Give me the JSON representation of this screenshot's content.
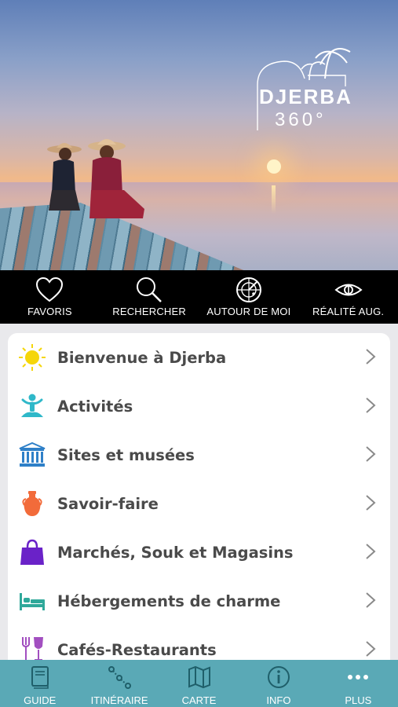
{
  "hero": {
    "logo_line1": "DJERBA",
    "logo_line2": "360°"
  },
  "actions": [
    {
      "label": "FAVORIS",
      "icon": "heart-icon"
    },
    {
      "label": "RECHERCHER",
      "icon": "search-icon"
    },
    {
      "label": "AUTOUR DE MOI",
      "icon": "radar-icon"
    },
    {
      "label": "RÉALITÉ AUG.",
      "icon": "eye-icon"
    }
  ],
  "menu": [
    {
      "label": "Bienvenue à Djerba",
      "icon": "sun-icon",
      "color": "#f5d60a"
    },
    {
      "label": "Activités",
      "icon": "yoga-icon",
      "color": "#2fb8c9"
    },
    {
      "label": "Sites et musées",
      "icon": "museum-icon",
      "color": "#2f80c8"
    },
    {
      "label": "Savoir-faire",
      "icon": "amphora-icon",
      "color": "#f26b3a"
    },
    {
      "label": "Marchés, Souk et Magasins",
      "icon": "shopping-bag-icon",
      "color": "#6a22c8"
    },
    {
      "label": "Hébergements de charme",
      "icon": "bed-icon",
      "color": "#2fa89a"
    },
    {
      "label": "Cafés-Restaurants",
      "icon": "cutlery-glass-icon",
      "color": "#a24fc0"
    }
  ],
  "tabs": [
    {
      "label": "GUIDE",
      "icon": "book-icon"
    },
    {
      "label": "ITINÉRAIRE",
      "icon": "route-icon"
    },
    {
      "label": "CARTE",
      "icon": "map-icon"
    },
    {
      "label": "INFO",
      "icon": "info-icon"
    },
    {
      "label": "PLUS",
      "icon": "more-dots-icon"
    }
  ],
  "colors": {
    "nav_background": "#5aa9b6",
    "action_bar_background": "#000000",
    "label_text": "#4a4a4a"
  }
}
